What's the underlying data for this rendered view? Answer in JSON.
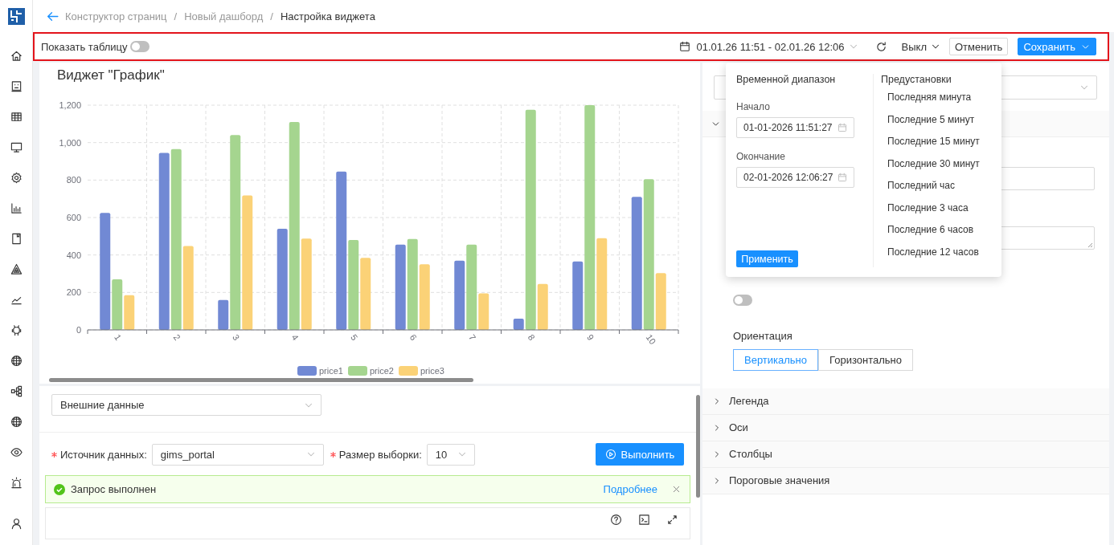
{
  "header": {
    "separator": "/",
    "breadcrumbs": [
      {
        "label": "Конструктор страниц",
        "current": false
      },
      {
        "label": "Новый дашборд",
        "current": false
      },
      {
        "label": "Настройка виджета",
        "current": true
      }
    ]
  },
  "toolbar": {
    "show_table": {
      "label": "Показать таблицу",
      "on": false
    },
    "time_range": "01.01.26 11:51 - 02.01.26 12:06",
    "refresh_mode": "Выкл",
    "buttons": [
      {
        "label": "Отменить",
        "kind": "default"
      },
      {
        "label": "Сохранить",
        "kind": "primary"
      }
    ]
  },
  "widget": {
    "title": "Виджет \"График\"",
    "chart_data": {
      "type": "bar",
      "grid": true,
      "legend": "bottom",
      "categories": [
        "1",
        "2",
        "3",
        "4",
        "5",
        "6",
        "7",
        "8",
        "9",
        "10"
      ],
      "ylim": [
        0,
        1200
      ],
      "yticks": [
        0,
        200,
        400,
        600,
        800,
        {
          "value": 1000,
          "label": "1,000"
        },
        {
          "value": 1200,
          "label": "1,200"
        }
      ],
      "series": [
        {
          "name": "price1",
          "color": "#7189d4",
          "values": [
            625,
            945,
            160,
            540,
            845,
            455,
            370,
            60,
            365,
            710
          ]
        },
        {
          "name": "price2",
          "color": "#a5d58f",
          "values": [
            270,
            965,
            1040,
            1110,
            480,
            485,
            455,
            1175,
            1200,
            805
          ]
        },
        {
          "name": "price3",
          "color": "#fbd277",
          "values": [
            185,
            448,
            718,
            488,
            385,
            350,
            195,
            245,
            490,
            303
          ]
        }
      ]
    }
  },
  "query": {
    "source_type": "Внешние данные",
    "fields": [
      {
        "label": "Источник данных:",
        "value": "gims_portal",
        "required": true
      },
      {
        "label": "Размер выборки:",
        "value": "10",
        "required": true
      }
    ],
    "run": "Выполнить",
    "alert": {
      "message": "Запрос выполнен",
      "link": "Подробнее"
    }
  },
  "settings": {
    "open_section": {
      "expanded": true
    },
    "toggle": {
      "on": false
    },
    "orientation": {
      "label": "Ориентация",
      "options": [
        {
          "label": "Вертикально",
          "selected": true
        },
        {
          "label": "Горизонтально",
          "selected": false
        }
      ]
    },
    "sections": [
      {
        "label": "Легенда",
        "expanded": false
      },
      {
        "label": "Оси",
        "expanded": false
      },
      {
        "label": "Столбцы",
        "expanded": false
      },
      {
        "label": "Пороговые значения",
        "expanded": false
      }
    ]
  },
  "time_popup": {
    "title": "Временной диапазон",
    "start": {
      "label": "Начало",
      "value": "01-01-2026 11:51:27"
    },
    "end": {
      "label": "Окончание",
      "value": "02-01-2026 12:06:27"
    },
    "apply": "Применить",
    "presets_title": "Предустановки",
    "presets": [
      "Последняя минута",
      "Последние 5 минут",
      "Последние 15 минут",
      "Последние 30 минут",
      "Последний час",
      "Последние 3 часа",
      "Последние 6 часов",
      "Последние 12 часов"
    ]
  }
}
